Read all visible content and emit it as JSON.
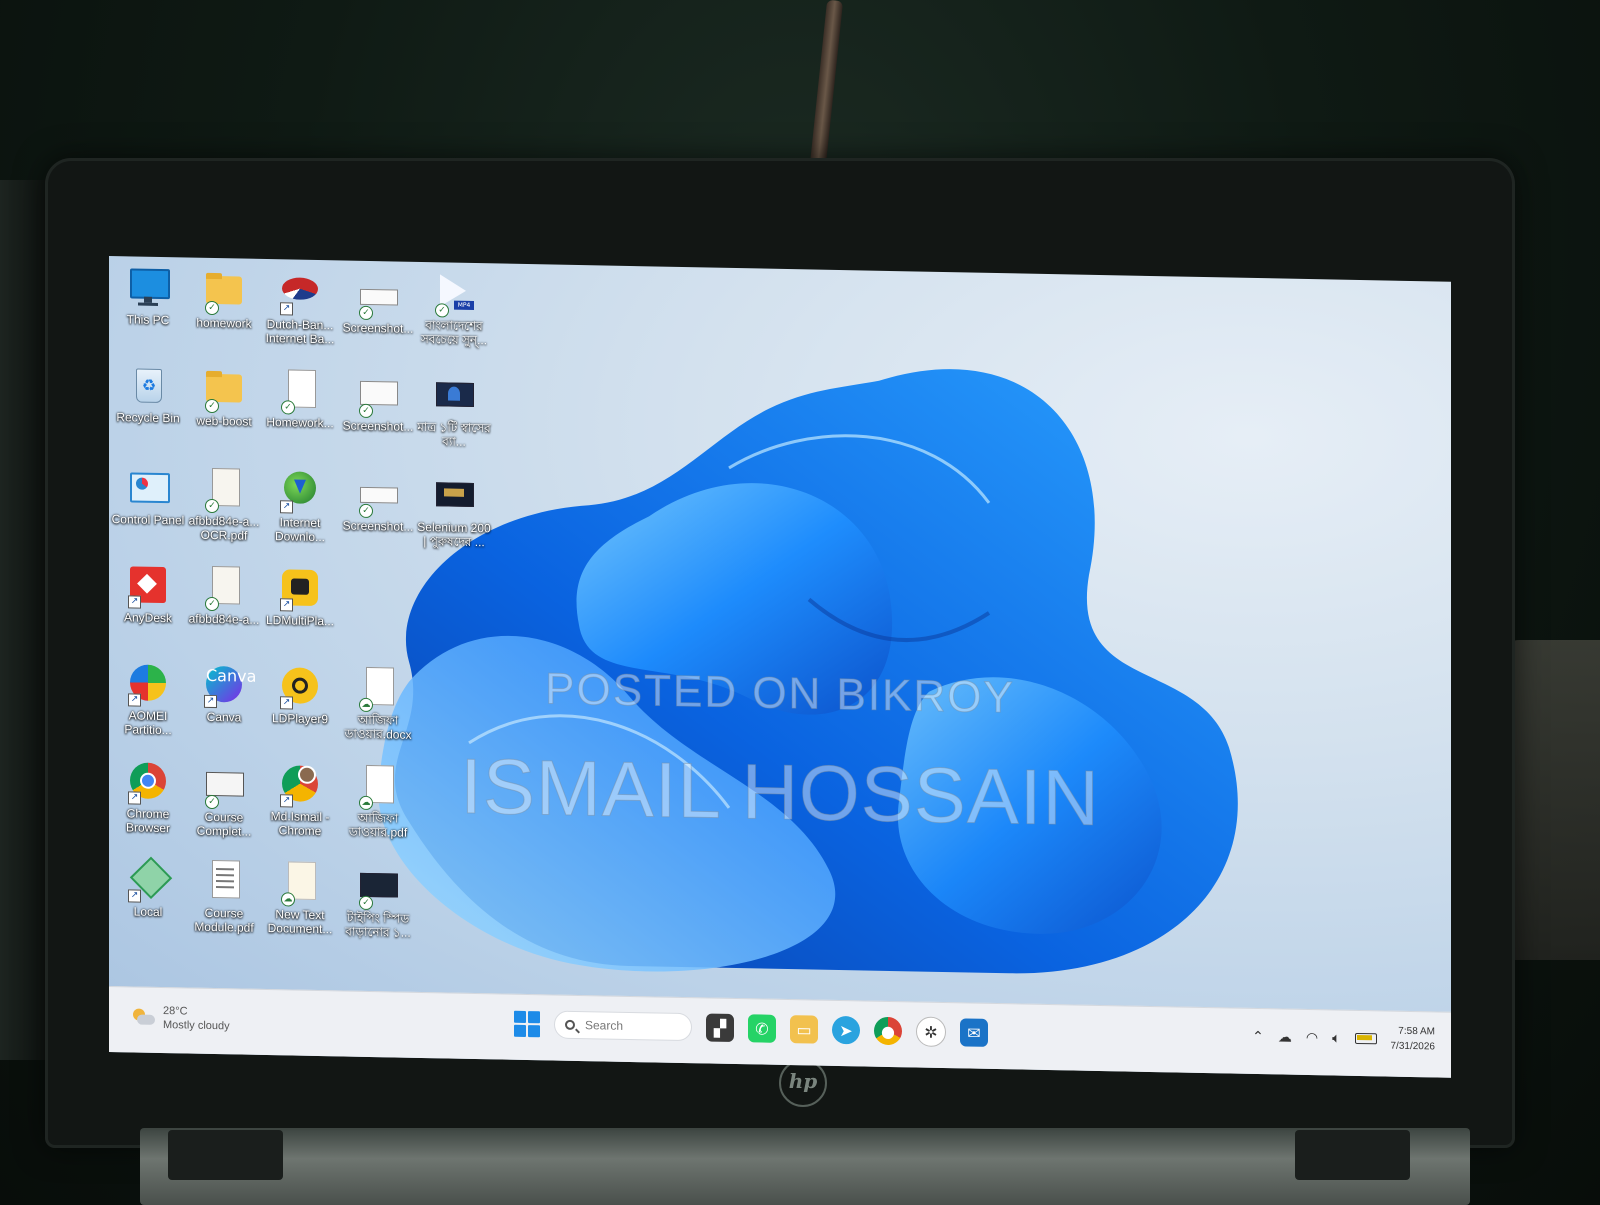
{
  "desktop": {
    "icons": [
      {
        "label": "This PC"
      },
      {
        "label": "homework"
      },
      {
        "label": "Dutch-Ban... Internet Ba..."
      },
      {
        "label": "Screenshot..."
      },
      {
        "label": "বাংলাদেশের সবচেয়ে সুন্..."
      },
      {
        "label": "Recycle Bin"
      },
      {
        "label": "web-boost"
      },
      {
        "label": "Homework..."
      },
      {
        "label": "Screenshot..."
      },
      {
        "label": "মাত্র ১টি স্বাসের ব্যা..."
      },
      {
        "label": "Control Panel"
      },
      {
        "label": "afbbd84e-a... OCR.pdf"
      },
      {
        "label": "Internet Downlo..."
      },
      {
        "label": "Screenshot..."
      },
      {
        "label": "Selenium 200 | পুরুষদের ..."
      },
      {
        "label": "AnyDesk"
      },
      {
        "label": "afbbd84e-a..."
      },
      {
        "label": "LDMultiPla..."
      },
      {
        "label": "AOMEI Partitio..."
      },
      {
        "label": "Canva"
      },
      {
        "label": "LDPlayer9"
      },
      {
        "label": "আজিফা ডাওয়ার.docx"
      },
      {
        "label": "Chrome Browser"
      },
      {
        "label": "Course Complet..."
      },
      {
        "label": "Md.Ismail - Chrome"
      },
      {
        "label": "আজিফা ডাওয়ার.pdf"
      },
      {
        "label": "Local"
      },
      {
        "label": "Course Module.pdf"
      },
      {
        "label": "New Text Document..."
      },
      {
        "label": "টাইপিং স্পিড বাড়ানোর ১..."
      }
    ]
  },
  "watermark": {
    "line1": "POSTED ON BIKROY",
    "line2": "ISMAIL HOSSAIN"
  },
  "taskbar": {
    "weather_temp": "28°C",
    "weather_desc": "Mostly cloudy",
    "search_placeholder": "Search",
    "apps": [
      {
        "name": "task-view",
        "color": "#3a3a3a",
        "glyph": "▞"
      },
      {
        "name": "whatsapp",
        "color": "#25d366",
        "glyph": "✆"
      },
      {
        "name": "file-explorer",
        "color": "#f2c14e",
        "glyph": "▭"
      },
      {
        "name": "telegram",
        "color": "#2aa3df",
        "glyph": "➤"
      },
      {
        "name": "chrome",
        "color": "#db4437",
        "glyph": "◉"
      },
      {
        "name": "chatgpt",
        "color": "#444444",
        "glyph": "✲"
      },
      {
        "name": "outlook",
        "color": "#1a73c7",
        "glyph": "✉"
      }
    ],
    "time": "7:58 AM",
    "date": "7/31/2026"
  },
  "laptop": {
    "brand": "hp"
  }
}
